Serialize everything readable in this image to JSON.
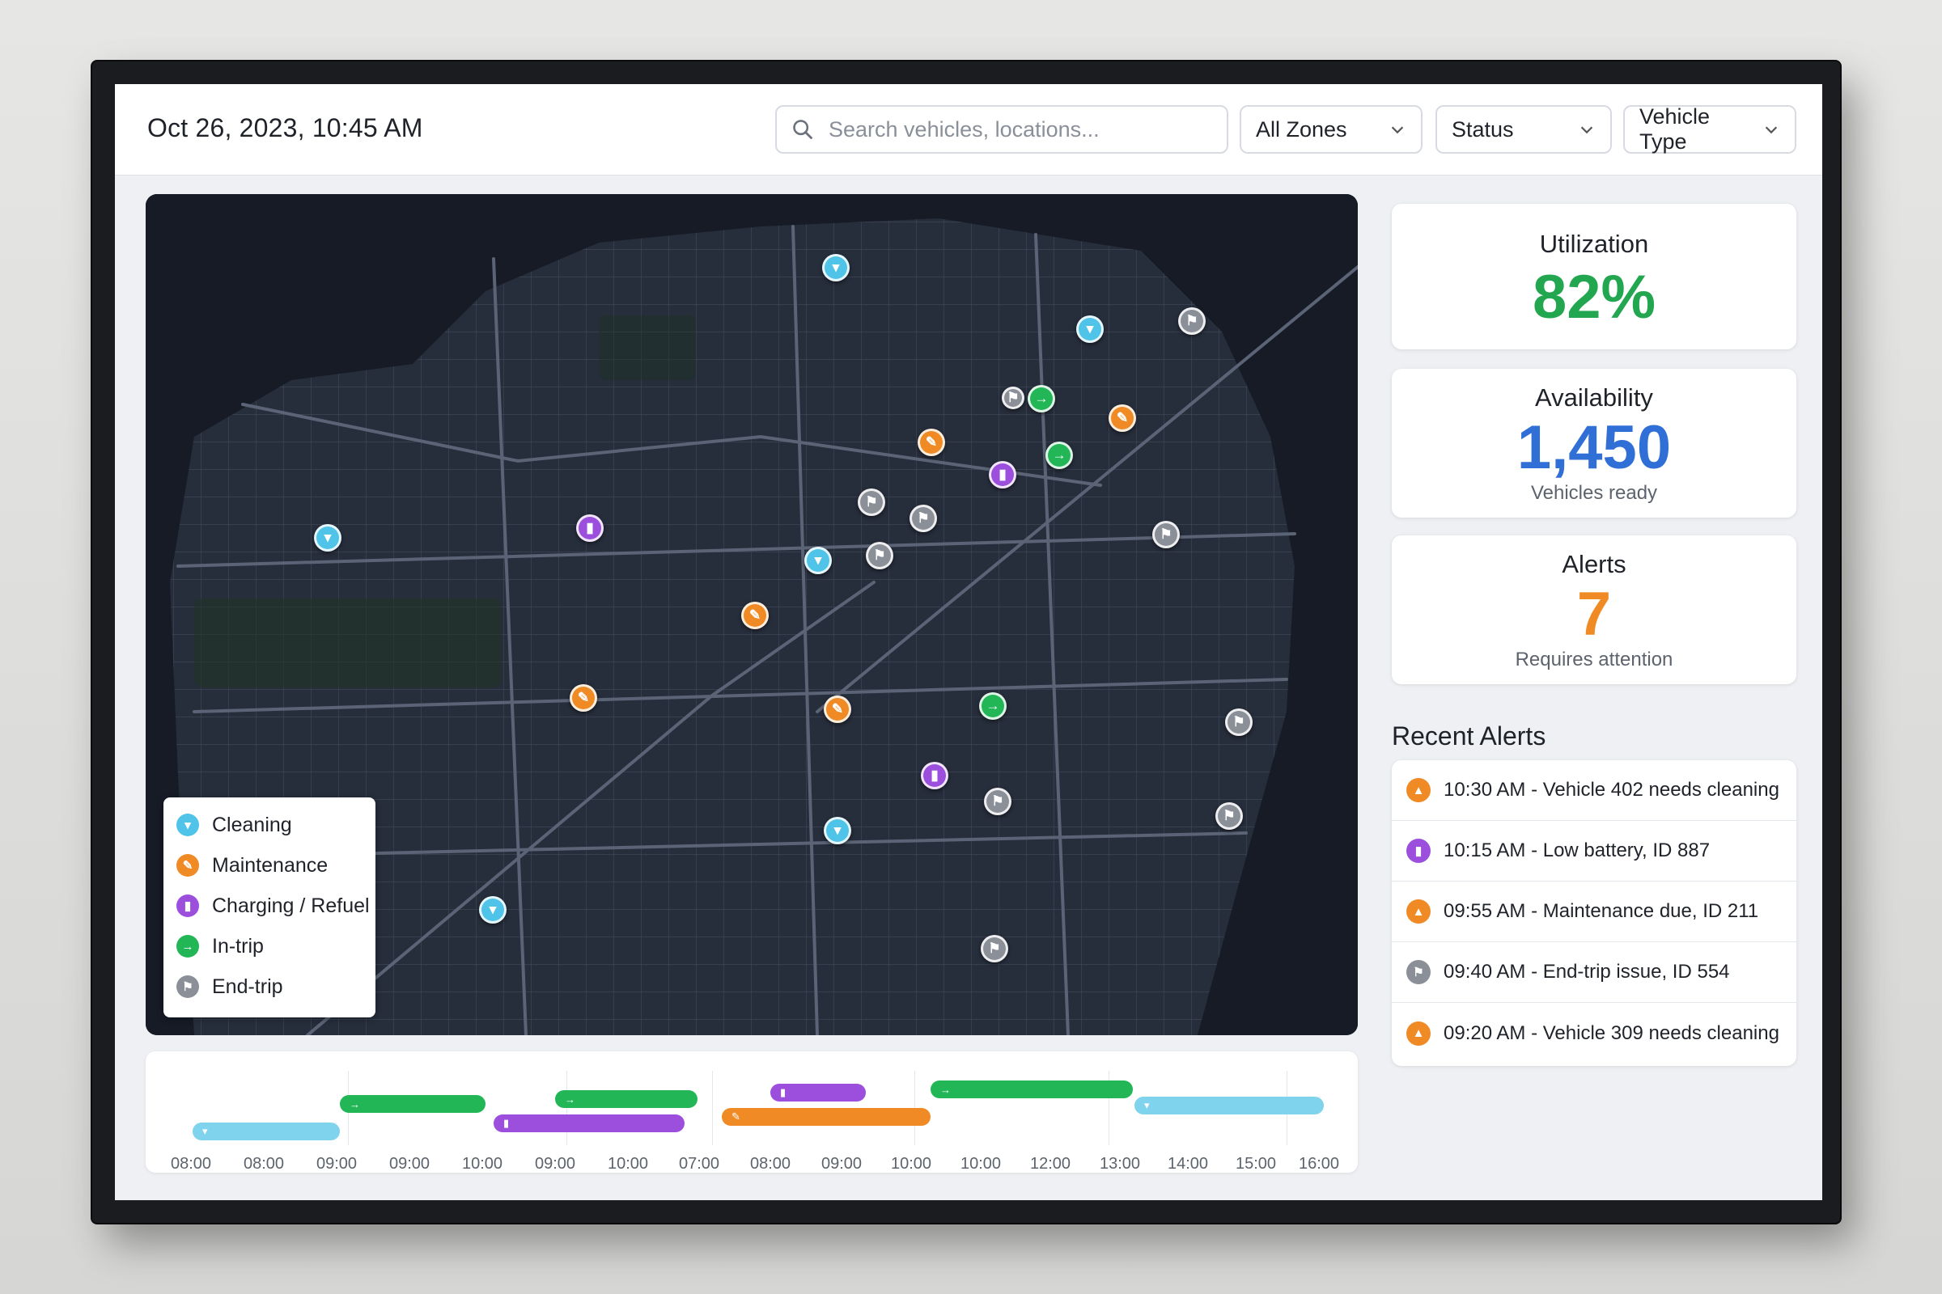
{
  "header": {
    "datetime": "Oct 26, 2023, 10:45 AM",
    "search_placeholder": "Search vehicles, locations...",
    "filters": [
      "All Zones",
      "Status",
      "Vehicle Type"
    ]
  },
  "colors": {
    "cleaning": "#4fc3e8",
    "maintenance": "#f08a24",
    "charging": "#9b4fdc",
    "intrip": "#22b657",
    "endtrip": "#8b9098",
    "utilization": "#22a650",
    "availability": "#2f6fd6",
    "alerts": "#f08a24"
  },
  "legend": {
    "items": [
      {
        "label": "Cleaning",
        "type": "cleaning",
        "icon": "spray-bottle-icon"
      },
      {
        "label": "Maintenance",
        "type": "maintenance",
        "icon": "wrench-icon"
      },
      {
        "label": "Charging / Refuel",
        "type": "charging",
        "icon": "fuel-pump-icon"
      },
      {
        "label": "In-trip",
        "type": "intrip",
        "icon": "arrow-right-icon"
      },
      {
        "label": "End-trip",
        "type": "endtrip",
        "icon": "flag-icon"
      }
    ]
  },
  "kpis": {
    "utilization": {
      "label": "Utilization",
      "value": "82%"
    },
    "availability": {
      "label": "Availability",
      "value": "1,450",
      "sub": "Vehicles ready"
    },
    "alerts": {
      "label": "Alerts",
      "value": "7",
      "sub": "Requires attention"
    }
  },
  "recent_alerts": {
    "title": "Recent Alerts",
    "items": [
      {
        "text": "10:30 AM - Vehicle 402 needs cleaning",
        "type": "maintenance",
        "icon": "warning-icon"
      },
      {
        "text": "10:15 AM - Low battery, ID 887",
        "type": "charging",
        "icon": "battery-icon"
      },
      {
        "text": "09:55 AM - Maintenance due, ID 211",
        "type": "maintenance",
        "icon": "warning-icon"
      },
      {
        "text": "09:40 AM - End-trip issue, ID 554",
        "type": "endtrip",
        "icon": "flag-icon"
      },
      {
        "text": "09:20 AM - Vehicle 309 needs cleaning",
        "type": "maintenance",
        "icon": "warning-icon"
      }
    ]
  },
  "timeline": {
    "ticks": [
      "08:00",
      "08:00",
      "09:00",
      "09:00",
      "10:00",
      "09:00",
      "10:00",
      "07:00",
      "08:00",
      "09:00",
      "10:00",
      "10:00",
      "12:00",
      "13:00",
      "14:00",
      "15:00",
      "16:00"
    ]
  }
}
